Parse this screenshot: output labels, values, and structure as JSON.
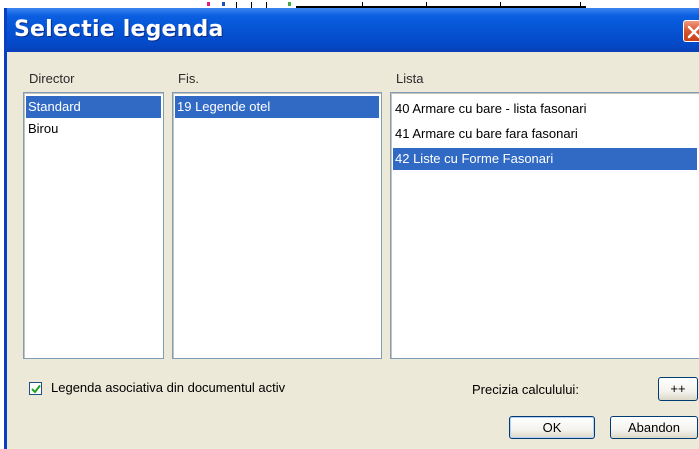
{
  "dialog": {
    "title": "Selectie legenda"
  },
  "columns": {
    "director": {
      "label": "Director",
      "items": [
        {
          "label": "Standard",
          "selected": true
        },
        {
          "label": "Birou",
          "selected": false
        }
      ]
    },
    "fis": {
      "label": "Fis.",
      "items": [
        {
          "label": "19 Legende otel",
          "selected": true
        }
      ]
    },
    "lista": {
      "label": "Lista",
      "items": [
        {
          "label": "40 Armare cu bare - lista fasonari",
          "selected": false
        },
        {
          "label": "41 Armare cu bare fara fasonari",
          "selected": false
        },
        {
          "label": "42 Liste cu Forme Fasonari",
          "selected": true
        }
      ]
    }
  },
  "options": {
    "associative_label": "Legenda asociativa din documentul activ",
    "associative_checked": true,
    "precision_label": "Precizia calculului:",
    "precision_value": "++"
  },
  "buttons": {
    "ok": "OK",
    "cancel": "Abandon"
  },
  "colors": {
    "titlebar": "#0554d4",
    "selection": "#316ac5",
    "dialog_bg": "#ece9d8"
  }
}
